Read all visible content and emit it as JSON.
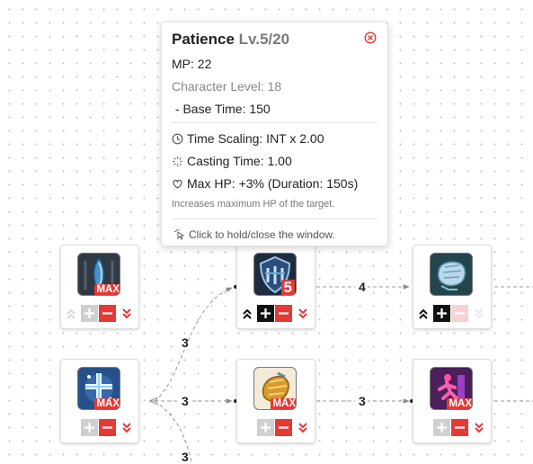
{
  "colors": {
    "accent_red": "#e53935",
    "active_black": "#111111",
    "disabled_gray": "#cccccc",
    "disabled_pink": "#f6d3d3",
    "link_gray": "#9a9a9a"
  },
  "tooltip": {
    "skill_name": "Patience",
    "level_text": "Lv.5/20",
    "close_icon": "close-circle-icon",
    "mp": "MP: 22",
    "char_level": "Character Level: 18",
    "base_time": " - Base Time: 150",
    "time_scaling": "Time Scaling: INT x 2.00",
    "casting_time": "Casting Time: 1.00",
    "max_hp": "Max HP: +3% (Duration: 150s)",
    "description": "Increases maximum HP of the target.",
    "hint": "Click to hold/close the window."
  },
  "nodes": {
    "n1": {
      "icon": "blue-crystal-icon",
      "badge": "MAX",
      "minus_enabled": true,
      "plus_enabled": false
    },
    "n2": {
      "icon": "shield-helmet-icon",
      "badge": "5",
      "minus_enabled": true,
      "plus_enabled": true
    },
    "n3": {
      "icon": "fist-gauntlet-icon",
      "badge": "",
      "minus_enabled": false,
      "plus_enabled": true
    },
    "n4": {
      "icon": "holy-cross-icon",
      "badge": "MAX",
      "minus_enabled": true,
      "plus_enabled": false
    },
    "n5": {
      "icon": "golden-fist-icon",
      "badge": "MAX",
      "minus_enabled": true,
      "plus_enabled": false
    },
    "n6": {
      "icon": "running-figure-icon",
      "badge": "MAX",
      "minus_enabled": true,
      "plus_enabled": false
    }
  },
  "links": {
    "top_right": "4",
    "branch_up": "3",
    "branch_mid": "3",
    "branch_down": "3",
    "bottom_right": "3"
  }
}
